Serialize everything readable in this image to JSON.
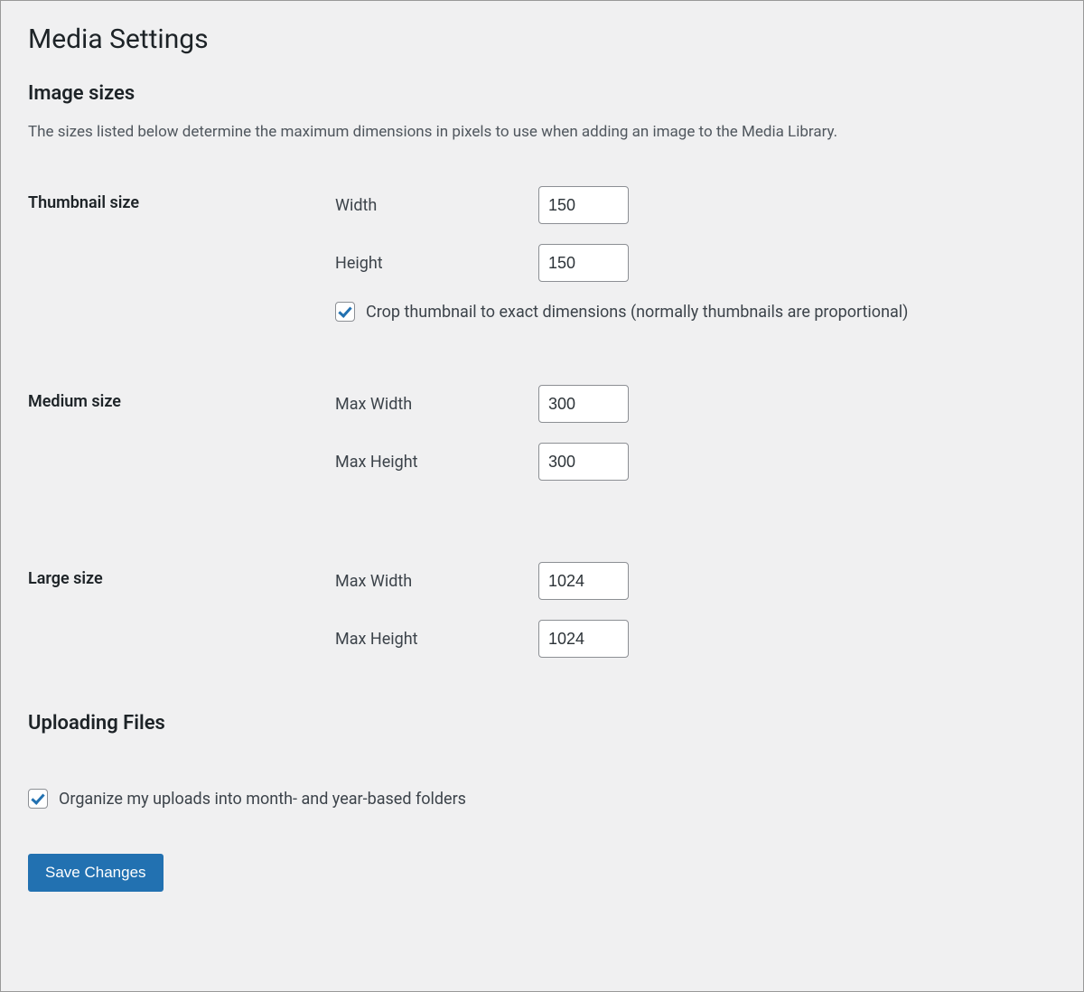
{
  "page": {
    "title": "Media Settings"
  },
  "image_sizes": {
    "heading": "Image sizes",
    "description": "The sizes listed below determine the maximum dimensions in pixels to use when adding an image to the Media Library.",
    "thumbnail": {
      "row_label": "Thumbnail size",
      "width_label": "Width",
      "width_value": "150",
      "height_label": "Height",
      "height_value": "150",
      "crop_label": "Crop thumbnail to exact dimensions (normally thumbnails are proportional)",
      "crop_checked": true
    },
    "medium": {
      "row_label": "Medium size",
      "max_width_label": "Max Width",
      "max_width_value": "300",
      "max_height_label": "Max Height",
      "max_height_value": "300"
    },
    "large": {
      "row_label": "Large size",
      "max_width_label": "Max Width",
      "max_width_value": "1024",
      "max_height_label": "Max Height",
      "max_height_value": "1024"
    }
  },
  "uploading_files": {
    "heading": "Uploading Files",
    "organize_label": "Organize my uploads into month- and year-based folders",
    "organize_checked": true
  },
  "actions": {
    "save_label": "Save Changes"
  }
}
